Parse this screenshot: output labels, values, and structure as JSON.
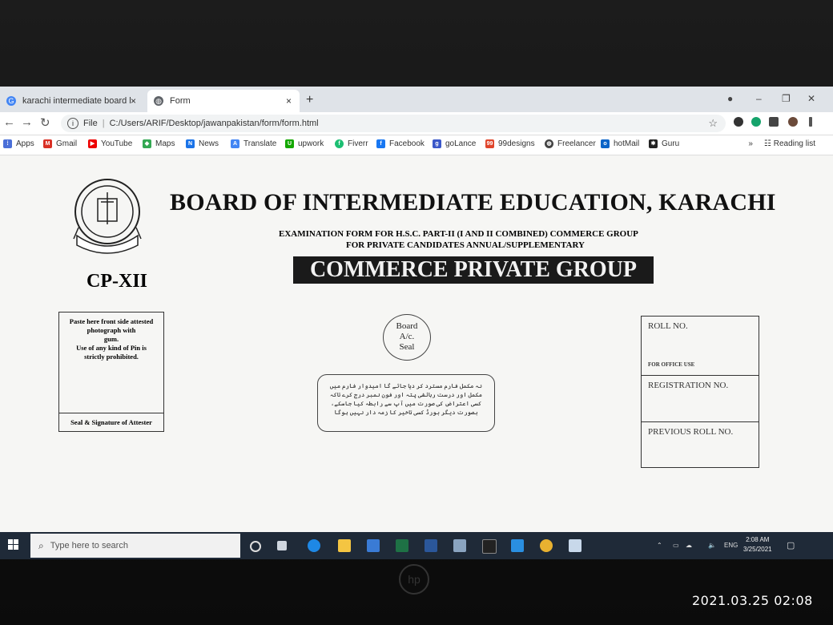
{
  "browser": {
    "tabs": [
      {
        "label": "karachi intermediate board logo",
        "close": "×"
      },
      {
        "label": "Form",
        "close": "×"
      }
    ],
    "new_tab": "+",
    "address": {
      "file_label": "File",
      "url": "C:/Users/ARIF/Desktop/jawanpakistan/form/form.html"
    },
    "bookmarks": [
      "Apps",
      "Gmail",
      "YouTube",
      "Maps",
      "News",
      "Translate",
      "upwork",
      "Fiverr",
      "Facebook",
      "goLance",
      "99designs",
      "Freelancer",
      "hotMail",
      "Guru"
    ],
    "overflow": "»",
    "reading_list": "Reading list"
  },
  "form": {
    "title": "BOARD OF INTERMEDIATE EDUCATION, KARACHI",
    "subtitle_line1": "EXAMINATION FORM FOR H.S.C. PART-II (I AND II COMBINED) COMMERCE GROUP",
    "subtitle_line2": "FOR PRIVATE CANDIDATES ANNUAL/SUPPLEMENTARY",
    "banner": "COMMERCE PRIVATE GROUP",
    "code": "CP-XII",
    "logo_text": "BOARD OF INTERMEDIATE EDUCATION KARACHI",
    "photo_instructions": [
      "Paste here front side attested",
      "photograph with",
      "gum.",
      "Use of any kind of Pin is",
      "strictly prohibited."
    ],
    "attester_label": "Seal & Signature of Attester",
    "seal": [
      "Board",
      "A/c.",
      "Seal"
    ],
    "urdu_note": "نہ مکمل فارم مسترد کر دیا جائے گا امیدوار فارم میں مکمل اور درست رہائشی پتہ اور فون نمبر درج کرے تاکہ کسی اعتراض کی صورت میں آپ سے رابطہ کیا جاسکے، بصورت دیگر بورڈ کسی تاخیر کا زمہ دار نہیں ہوگا",
    "office": {
      "roll_no": "ROLL NO.",
      "for_office_use": "FOR OFFICE USE",
      "registration_no": "REGISTRATION NO.",
      "previous_roll_no": "PREVIOUS ROLL NO."
    }
  },
  "taskbar": {
    "search_placeholder": "Type here to search",
    "time": "2:08 AM",
    "date": "3/25/2021",
    "lang": "ENG"
  },
  "photo_timestamp": "2021.03.25 02:08",
  "colors": {
    "taskbar": "#1f2a38",
    "banner": "#1a1a1a",
    "tabstrip": "#dfe3e8"
  }
}
